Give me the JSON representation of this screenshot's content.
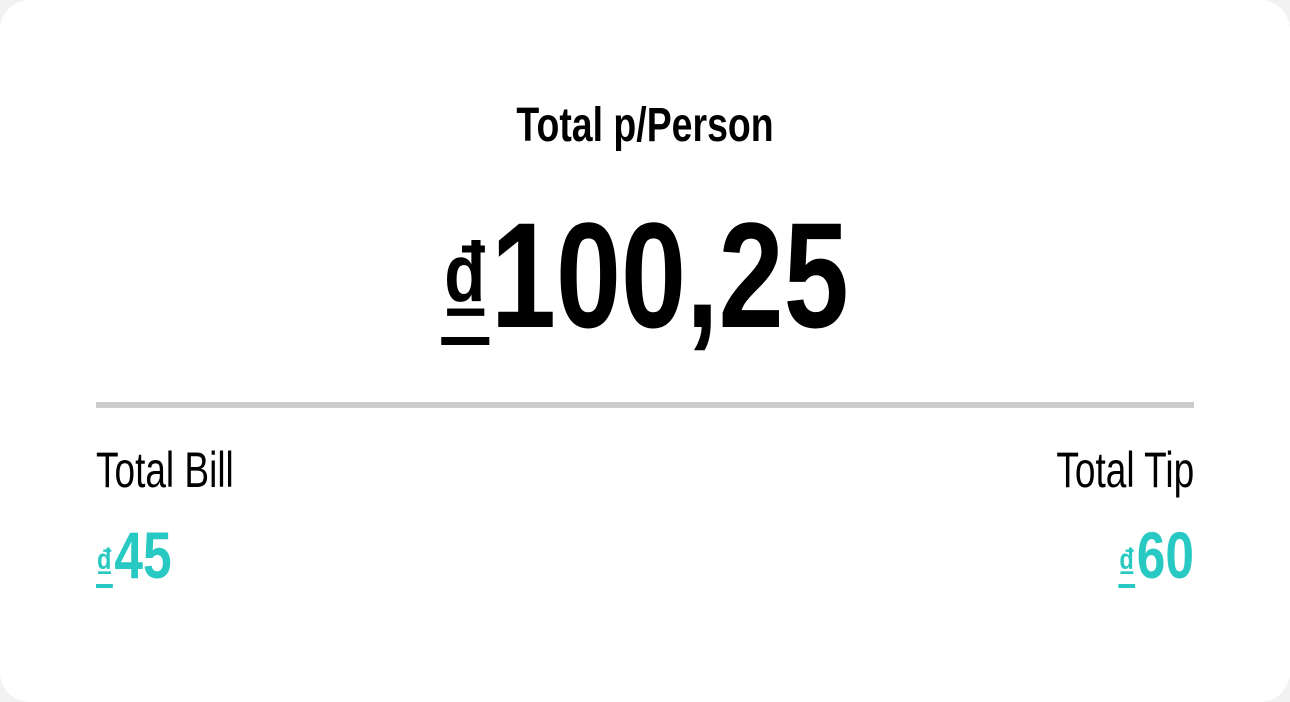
{
  "summary": {
    "heading": "Total p/Person",
    "per_person": {
      "currency": "₫",
      "amount": "100,25"
    },
    "total_bill": {
      "label": "Total Bill",
      "currency": "₫",
      "amount": "45"
    },
    "total_tip": {
      "label": "Total Tip",
      "currency": "₫",
      "amount": "60"
    }
  },
  "colors": {
    "accent": "#27c9c2",
    "divider": "#cccccc",
    "text": "#000000",
    "background": "#ffffff"
  }
}
